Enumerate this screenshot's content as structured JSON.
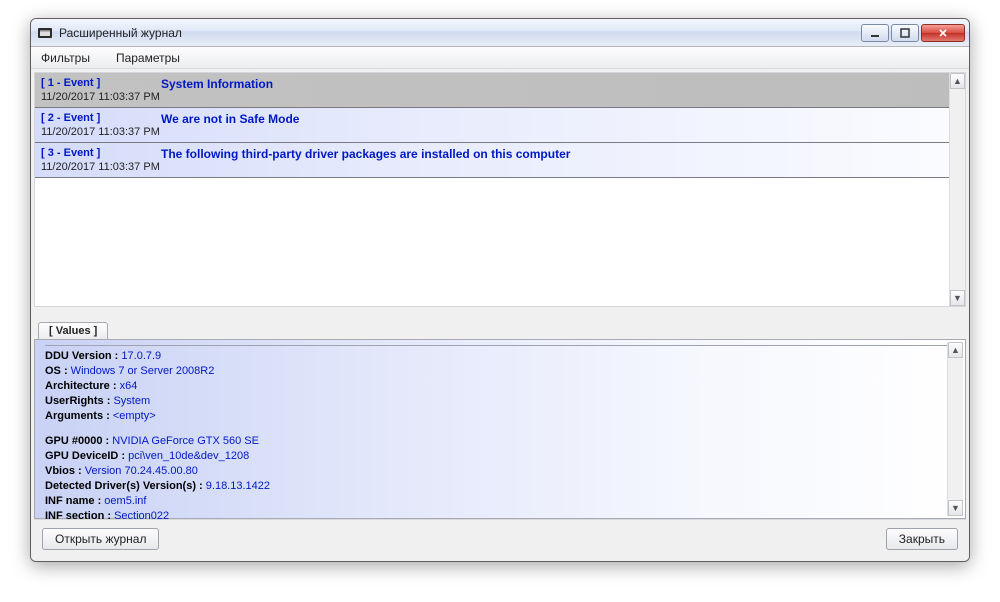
{
  "window": {
    "title": "Расширенный журнал"
  },
  "menubar": {
    "filters": "Фильтры",
    "params": "Параметры"
  },
  "log": {
    "rows": [
      {
        "id": "[ 1 - Event ]",
        "ts": "11/20/2017 11:03:37 PM",
        "msg": "System Information"
      },
      {
        "id": "[ 2 - Event ]",
        "ts": "11/20/2017 11:03:37 PM",
        "msg": "We are not in Safe Mode"
      },
      {
        "id": "[ 3 - Event ]",
        "ts": "11/20/2017 11:03:37 PM",
        "msg": "The following third-party driver packages are installed on this computer"
      }
    ]
  },
  "values": {
    "tab_label": "[ Values ]",
    "group1": [
      {
        "key": "DDU Version :",
        "val": " 17.0.7.9"
      },
      {
        "key": "OS :",
        "val": " Windows 7 or Server 2008R2"
      },
      {
        "key": "Architecture :",
        "val": " x64"
      },
      {
        "key": "UserRights :",
        "val": " System"
      },
      {
        "key": "Arguments :",
        "val": " <empty>"
      }
    ],
    "group2": [
      {
        "key": "GPU #0000 :",
        "val": " NVIDIA GeForce GTX 560 SE"
      },
      {
        "key": "GPU DeviceID :",
        "val": " pci\\ven_10de&dev_1208"
      },
      {
        "key": "Vbios :",
        "val": " Version 70.24.45.00.80"
      },
      {
        "key": "Detected Driver(s) Version(s) :",
        "val": " 9.18.13.1422"
      },
      {
        "key": "INF name :",
        "val": " oem5.inf"
      },
      {
        "key": "INF section :",
        "val": " Section022"
      }
    ]
  },
  "buttons": {
    "open_log": "Открыть журнал",
    "close": "Закрыть"
  }
}
